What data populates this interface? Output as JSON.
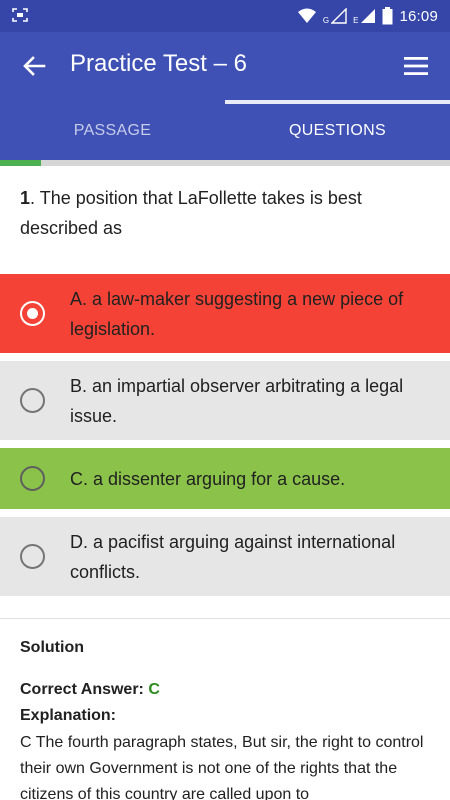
{
  "status_bar": {
    "time": "16:09",
    "icons": [
      "screenshot-icon",
      "wifi-icon",
      "signal-icon",
      "signal-icon",
      "battery-icon"
    ],
    "network_labels": [
      "G",
      "E"
    ]
  },
  "app_bar": {
    "title": "Practice Test – 6",
    "back_icon": "arrow-left-icon",
    "menu_icon": "menu-icon"
  },
  "tabs": [
    {
      "label": "PASSAGE",
      "active": false
    },
    {
      "label": "QUESTIONS",
      "active": true
    }
  ],
  "progress": {
    "fraction": 0.09
  },
  "question": {
    "number": "1",
    "text": ". The position that LaFollette takes is best described as"
  },
  "options": [
    {
      "text": "A. a law-maker suggesting a new piece of legislation.",
      "state": "selected-wrong"
    },
    {
      "text": "B. an impartial observer arbitrating a legal issue.",
      "state": "neutral"
    },
    {
      "text": "C. a dissenter arguing for a cause.",
      "state": "correct"
    },
    {
      "text": "D. a pacifist arguing against international conflicts.",
      "state": "neutral"
    }
  ],
  "solution": {
    "title": "Solution",
    "correct_answer_label": "Correct Answer: ",
    "correct_answer": "C",
    "explanation_label": "Explanation:",
    "explanation": "C The fourth paragraph states, But sir, the right to control their own Government is not one of the rights that the citizens of this country are called upon to"
  },
  "colors": {
    "status_bar": "#3646a8",
    "app_bar": "#3f51b5",
    "wrong": "#f44336",
    "correct": "#8bc34a",
    "neutral": "#e6e6e6",
    "progress": "#4caf50",
    "answer_letter": "#2e8b1f"
  }
}
